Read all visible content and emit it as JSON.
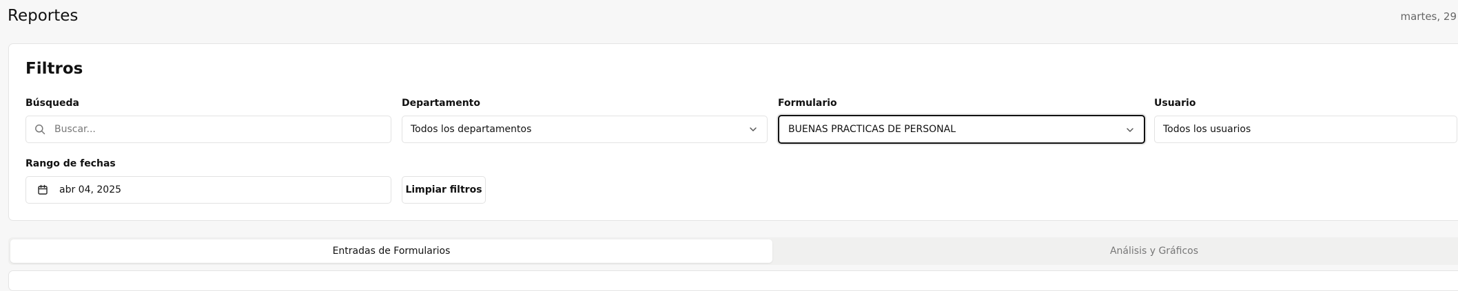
{
  "header": {
    "title": "Reportes",
    "date": "martes, 29"
  },
  "filters": {
    "title": "Filtros",
    "search": {
      "label": "Búsqueda",
      "placeholder": "Buscar..."
    },
    "department": {
      "label": "Departamento",
      "value": "Todos los departamentos"
    },
    "form": {
      "label": "Formulario",
      "value": "BUENAS PRACTICAS DE PERSONAL"
    },
    "user": {
      "label": "Usuario",
      "value": "Todos los usuarios"
    },
    "date_range": {
      "label": "Rango de fechas",
      "value": "abr 04, 2025"
    },
    "clear_label": "Limpiar filtros"
  },
  "tabs": [
    {
      "label": "Entradas de Formularios",
      "active": true
    },
    {
      "label": "Análisis y Gráficos",
      "active": false
    }
  ]
}
